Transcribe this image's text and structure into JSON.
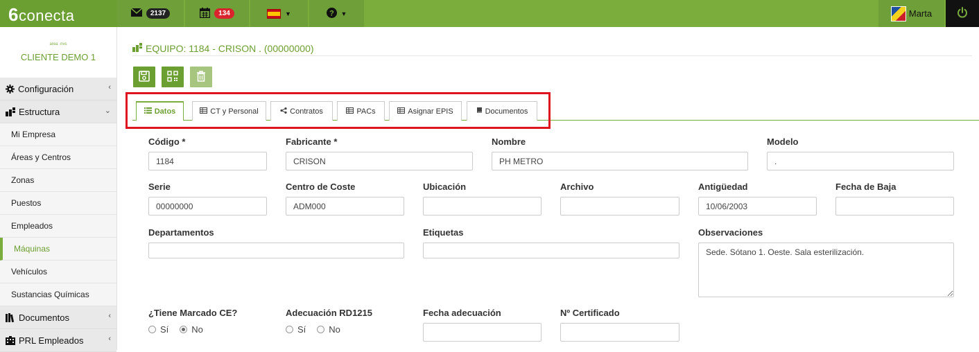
{
  "app": {
    "logo_digit": "6",
    "logo_text": "conecta"
  },
  "topbar": {
    "messages_count": "2137",
    "calendar_count": "134",
    "user_name": "Marta"
  },
  "sidebar": {
    "client_brand": "area ·nvs",
    "client_name": "CLIENTE DEMO 1",
    "sections": {
      "configuracion": "Configuración",
      "estructura": "Estructura",
      "documentos": "Documentos",
      "prl": "PRL Empleados"
    },
    "items": [
      {
        "label": "Mi Empresa"
      },
      {
        "label": "Áreas y Centros"
      },
      {
        "label": "Zonas"
      },
      {
        "label": "Puestos"
      },
      {
        "label": "Empleados"
      },
      {
        "label": "Máquinas"
      },
      {
        "label": "Vehículos"
      },
      {
        "label": "Sustancias Químicas"
      }
    ]
  },
  "page": {
    "title": "EQUIPO: 1184 - CRISON . (00000000)"
  },
  "tabs": [
    {
      "label": "Datos"
    },
    {
      "label": "CT y Personal"
    },
    {
      "label": "Contratos"
    },
    {
      "label": "PACs"
    },
    {
      "label": "Asignar EPIS"
    },
    {
      "label": "Documentos"
    }
  ],
  "form": {
    "codigo": {
      "label": "Código *",
      "value": "1184"
    },
    "fabricante": {
      "label": "Fabricante *",
      "value": "CRISON"
    },
    "nombre": {
      "label": "Nombre",
      "value": "PH METRO"
    },
    "modelo": {
      "label": "Modelo",
      "value": "."
    },
    "serie": {
      "label": "Serie",
      "value": "00000000"
    },
    "centro_coste": {
      "label": "Centro de Coste",
      "value": "ADM000"
    },
    "ubicacion": {
      "label": "Ubicación",
      "value": ""
    },
    "archivo": {
      "label": "Archivo",
      "value": ""
    },
    "antiguedad": {
      "label": "Antigüedad",
      "value": "10/06/2003"
    },
    "fecha_baja": {
      "label": "Fecha de Baja",
      "value": ""
    },
    "departamentos": {
      "label": "Departamentos",
      "value": ""
    },
    "etiquetas": {
      "label": "Etiquetas",
      "value": ""
    },
    "observaciones": {
      "label": "Observaciones",
      "value": "Sede. Sótano 1. Oeste. Sala esterilización."
    },
    "marcado_ce": {
      "label": "¿Tiene Marcado CE?",
      "opt_yes": "Sí",
      "opt_no": "No",
      "selected": "No"
    },
    "adecuacion": {
      "label": "Adecuación RD1215",
      "opt_yes": "Sí",
      "opt_no": "No",
      "selected": ""
    },
    "fecha_adecuacion": {
      "label": "Fecha adecuación",
      "value": ""
    },
    "certificado": {
      "label": "Nº Certificado",
      "value": ""
    }
  },
  "colors": {
    "brand_green": "#7aad3c",
    "dark_green": "#6c9f31",
    "highlight_red": "#e0141f"
  }
}
